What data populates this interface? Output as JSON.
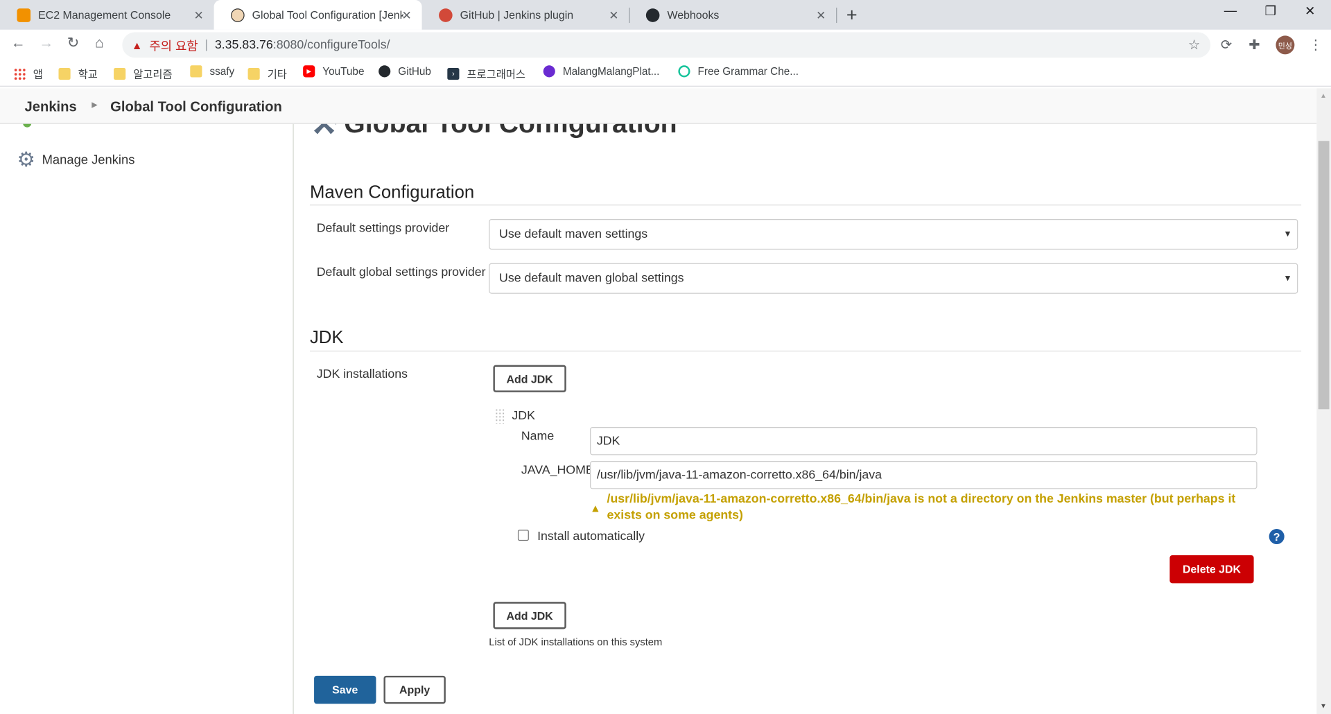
{
  "browser": {
    "tabs": [
      {
        "title": "EC2 Management Console",
        "favicon": "aws-box-icon"
      },
      {
        "title": "Global Tool Configuration [Jenk",
        "favicon": "jenkins-icon"
      },
      {
        "title": "GitHub | Jenkins plugin",
        "favicon": "jenkins-plugin-icon"
      },
      {
        "title": "Webhooks",
        "favicon": "github-icon"
      }
    ],
    "close_glyph": "✕",
    "new_tab_glyph": "+",
    "window_controls": {
      "minimize": "—",
      "maximize": "❐",
      "close": "✕"
    },
    "address": {
      "warning_glyph": "▲",
      "warning_text": "주의 요함",
      "separator": "|",
      "host": "3.35.83.76",
      "path": ":8080/configureTools/"
    },
    "profile_initials": "민성",
    "bookmarks": [
      {
        "label": "앱",
        "icon": "apps-grid-icon"
      },
      {
        "label": "학교",
        "icon": "folder-icon"
      },
      {
        "label": "알고리즘",
        "icon": "folder-icon"
      },
      {
        "label": "ssafy",
        "icon": "folder-icon"
      },
      {
        "label": "기타",
        "icon": "folder-icon"
      },
      {
        "label": "YouTube",
        "icon": "youtube-icon"
      },
      {
        "label": "GitHub",
        "icon": "github-icon"
      },
      {
        "label": "프로그래머스",
        "icon": "programmers-icon"
      },
      {
        "label": "MalangMalangPlat...",
        "icon": "malang-icon"
      },
      {
        "label": "Free Grammar Che...",
        "icon": "grammar-icon"
      }
    ]
  },
  "breadcrumb": {
    "root": "Jenkins",
    "separator": "▶",
    "current": "Global Tool Configuration"
  },
  "sidebar": {
    "manage_label": "Manage Jenkins"
  },
  "page": {
    "title": "Global Tool Configuration",
    "maven": {
      "heading": "Maven Configuration",
      "default_settings_label": "Default settings provider",
      "default_settings_value": "Use default maven settings",
      "global_settings_label": "Default global settings provider",
      "global_settings_value": "Use default maven global settings"
    },
    "jdk": {
      "heading": "JDK",
      "installations_label": "JDK installations",
      "add_button": "Add JDK",
      "entry_title": "JDK",
      "name_label": "Name",
      "name_value": "JDK",
      "home_label": "JAVA_HOME",
      "home_value": "/usr/lib/jvm/java-11-amazon-corretto.x86_64/bin/java",
      "warning_glyph": "▲",
      "warning": "/usr/lib/jvm/java-11-amazon-corretto.x86_64/bin/java is not a directory on the Jenkins master (but perhaps it exists on some agents)",
      "install_auto_label": "Install automatically",
      "help_glyph": "?",
      "delete_button": "Delete JDK",
      "list_description": "List of JDK installations on this system"
    },
    "actions": {
      "save": "Save",
      "apply": "Apply"
    }
  },
  "colors": {
    "save_blue": "#20639b",
    "delete_red": "#cc0003",
    "warning_yellow": "#c4a000",
    "address_warning_red": "#c5221f"
  }
}
